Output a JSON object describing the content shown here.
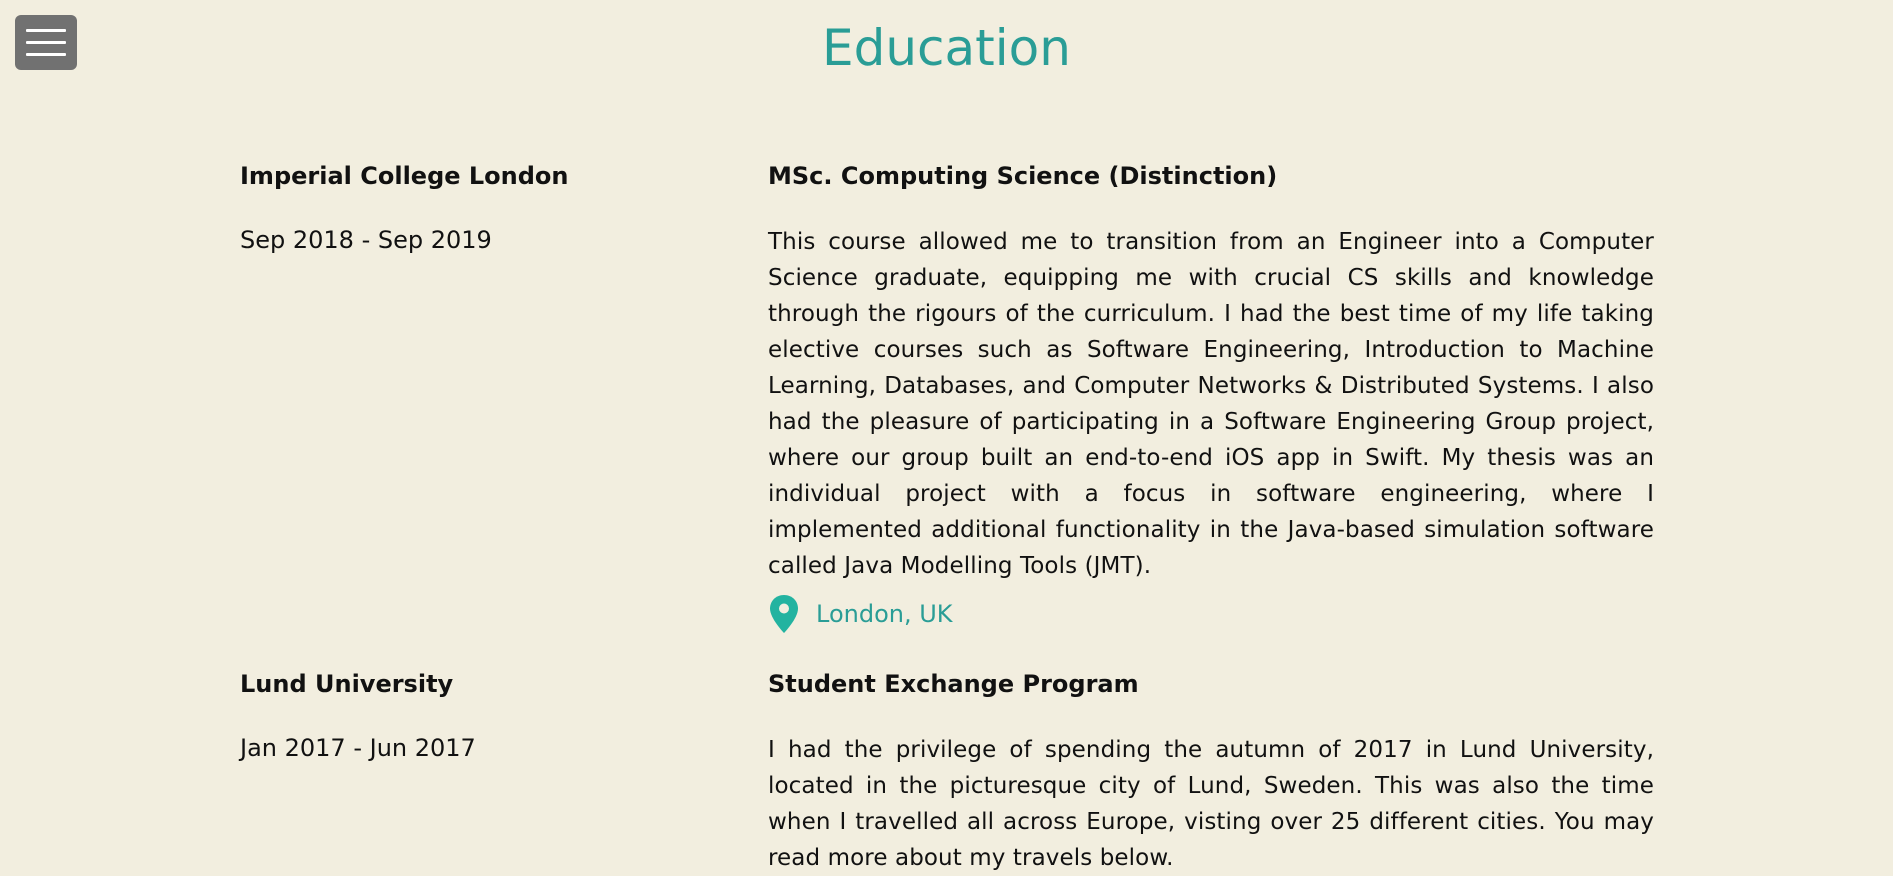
{
  "page": {
    "title": "Education"
  },
  "colors": {
    "background": "#f2eedf",
    "accent": "#2a9d96",
    "menu_button": "#717171",
    "pin": "#23b3a0"
  },
  "menu": {
    "icon": "hamburger-menu-icon"
  },
  "education": [
    {
      "institution": "Imperial College London",
      "dates": "Sep 2018 - Sep 2019",
      "degree": "MSc. Computing Science (Distinction)",
      "description": "This course allowed me to transition from an Engineer into a Computer Science graduate, equipping me with crucial CS skills and knowledge through the rigours of the curriculum. I had the best time of my life taking elective courses such as Software Engineering, Introduction to Machine Learning, Databases, and Computer Networks & Distributed Systems. I also had the pleasure of participating in a Software Engineering Group project, where our group built an end-to-end iOS app in Swift. My thesis was an individual project with a focus in software engineering, where I implemented additional functionality in the Java-based simulation software called Java Modelling Tools (JMT).",
      "location": "London, UK",
      "location_icon": "map-pin-icon"
    },
    {
      "institution": "Lund University",
      "dates": "Jan 2017 - Jun 2017",
      "degree": "Student Exchange Program",
      "description": "I had the privilege of spending the autumn of 2017 in Lund University, located in the picturesque city of Lund, Sweden. This was also the time when I travelled all across Europe, visting over 25 different cities. You may read more about my travels below."
    }
  ]
}
